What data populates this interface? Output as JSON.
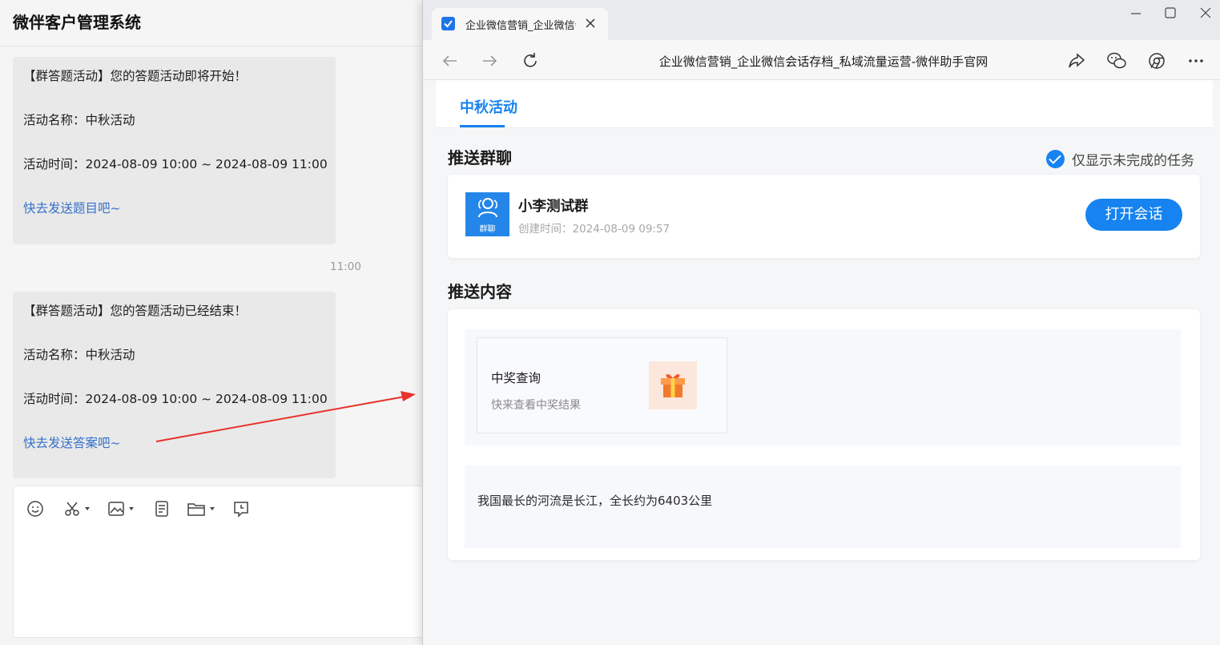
{
  "chat_app": {
    "title": "微伴客户管理系统",
    "messages": [
      {
        "header": "【群答题活动】您的答题活动即将开始！",
        "name_line": "活动名称：中秋活动",
        "time_line": "活动时间：2024-08-09 10:00 ~ 2024-08-09 11:00",
        "link": "快去发送题目吧~"
      },
      {
        "header": "【群答题活动】您的答题活动已经结束！",
        "name_line": "活动名称：中秋活动",
        "time_line": "活动时间：2024-08-09 10:00 ~ 2024-08-09 11:00",
        "link": "快去发送答案吧~"
      }
    ],
    "timestamp": "11:00",
    "composer_tools": [
      "emoji-icon",
      "scissors-icon",
      "image-icon",
      "document-icon",
      "folder-icon",
      "history-icon"
    ]
  },
  "browser": {
    "tab_title": "企业微信营销_企业微信会话存档_私域流量运营-微伴助手官网",
    "address_text": "企业微信营销_企业微信会话存档_私域流量运营-微伴助手官网",
    "accent_color": "#1683f0"
  },
  "page": {
    "tab_active": "中秋活动",
    "section_group": "推送群聊",
    "filter_label": "仅显示未完成的任务",
    "group": {
      "avatar_label": "群聊",
      "name": "小李测试群",
      "created": "创建时间：2024-08-09 09:57",
      "open_button": "打开会话"
    },
    "section_content": "推送内容",
    "link_card": {
      "title": "中奖查询",
      "desc": "快来查看中奖结果",
      "thumb_icon": "gift-box-icon"
    },
    "text_content": "我国最长的河流是长江，全长约为6403公里"
  }
}
